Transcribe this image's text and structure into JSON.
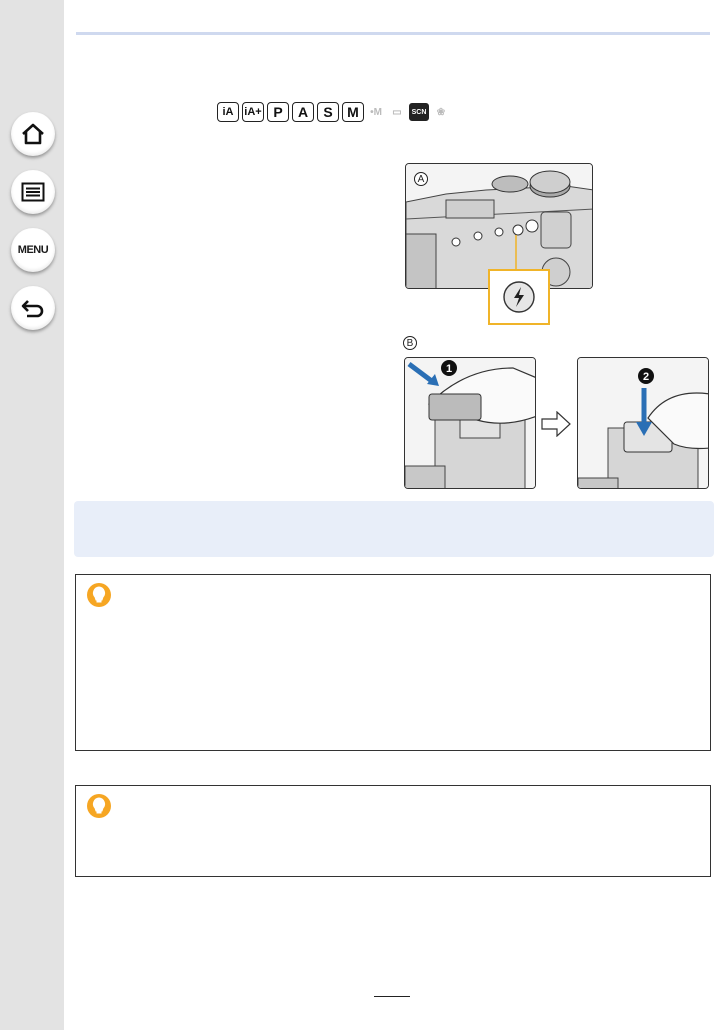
{
  "sidebar": {
    "buttons": [
      {
        "name": "home",
        "icon": "home-icon"
      },
      {
        "name": "contents",
        "icon": "list-icon"
      },
      {
        "name": "menu",
        "icon": "menu-icon",
        "label": "MENU"
      },
      {
        "name": "back",
        "icon": "back-arrow-icon"
      }
    ]
  },
  "modes": {
    "items": [
      "iA",
      "iA+",
      "P",
      "A",
      "S",
      "M",
      "•M",
      "▭",
      "SCN",
      "❀"
    ]
  },
  "figures": {
    "label_a": "A",
    "label_b": "B",
    "step1": "1",
    "step2": "2"
  },
  "colors": {
    "accent_line": "#cfd9ef",
    "info_band": "#e8eef9",
    "tip_icon": "#f6a623",
    "highlight_box": "#f0b429",
    "arrow_blue": "#2a6fb5"
  }
}
